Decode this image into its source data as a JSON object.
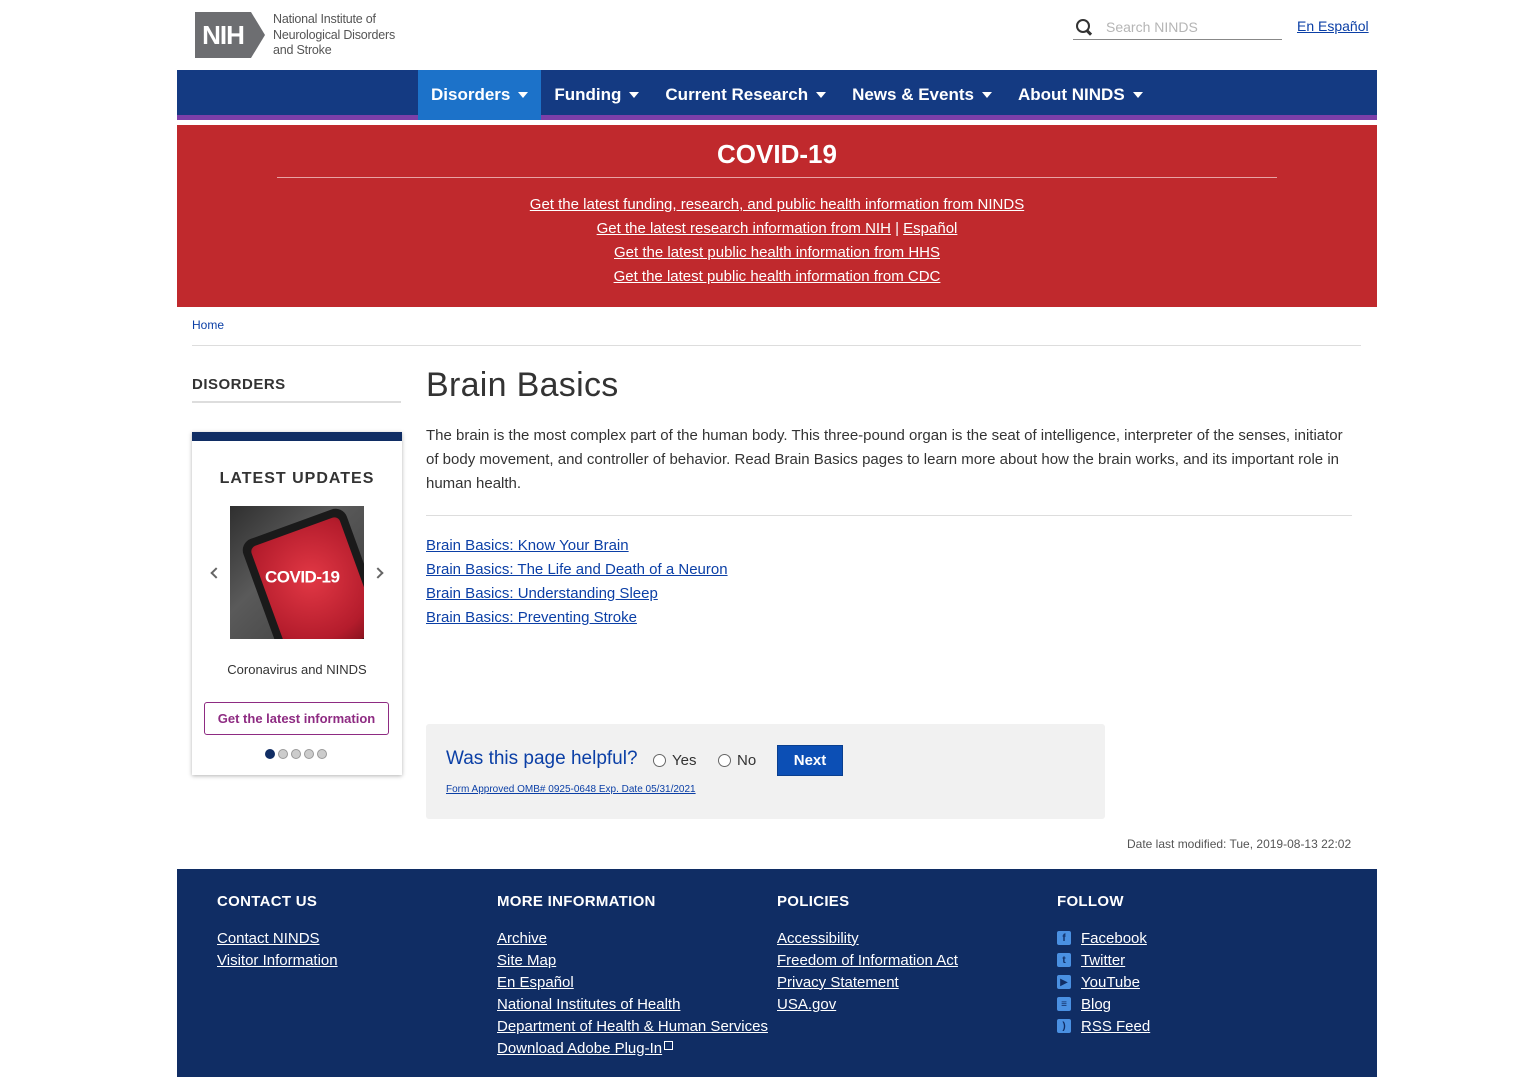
{
  "header": {
    "logo_abbr": "NIH",
    "logo_text_lines": [
      "National Institute of",
      "Neurological Disorders",
      "and Stroke"
    ],
    "search_placeholder": "Search NINDS",
    "espanol_link": "En Español"
  },
  "nav": {
    "items": [
      {
        "label": "Disorders",
        "active": true
      },
      {
        "label": "Funding",
        "active": false
      },
      {
        "label": "Current Research",
        "active": false
      },
      {
        "label": "News & Events",
        "active": false
      },
      {
        "label": "About NINDS",
        "active": false
      }
    ]
  },
  "covid": {
    "title": "COVID-19",
    "link1": "Get the latest funding, research, and public health information from NINDS",
    "link2a": "Get the latest research information from NIH",
    "separator": "|",
    "link2b": "Español",
    "link3": "Get the latest public health information from HHS",
    "link4": "Get the latest public health information from CDC"
  },
  "breadcrumb": {
    "home": "Home"
  },
  "sidebar": {
    "title": "DISORDERS",
    "updates_title": "LATEST UPDATES",
    "slide_image_text": "COVID-19",
    "slide_caption": "Coronavirus and NINDS",
    "slide_button": "Get the latest information",
    "slide_count": 5,
    "active_slide": 1
  },
  "main": {
    "title": "Brain Basics",
    "intro": "The brain is the most complex part of the human body. This three-pound organ is the seat of intelligence, interpreter of the senses, initiator of body movement, and controller of behavior. Read Brain Basics pages to learn more about how the brain works, and its important role in human health.",
    "links": [
      "Brain Basics: Know Your Brain",
      "Brain Basics: The Life and Death of a Neuron",
      "Brain Basics: Understanding Sleep",
      "Brain Basics: Preventing Stroke"
    ]
  },
  "feedback": {
    "question": "Was this page helpful?",
    "yes": "Yes",
    "no": "No",
    "next": "Next",
    "omb": "Form Approved OMB# 0925-0648 Exp. Date 05/31/2021"
  },
  "modified": "Date last modified: Tue, 2019-08-13 22:02",
  "footer": {
    "contact": {
      "title": "CONTACT US",
      "links": [
        "Contact NINDS",
        "Visitor Information"
      ]
    },
    "more": {
      "title": "MORE INFORMATION",
      "links": [
        "Archive",
        "Site Map",
        "En Español",
        "National Institutes of Health",
        "Department of Health & Human Services",
        "Download Adobe Plug-In"
      ]
    },
    "policies": {
      "title": "POLICIES",
      "links": [
        "Accessibility",
        "Freedom of Information Act",
        "Privacy Statement",
        "USA.gov"
      ]
    },
    "follow": {
      "title": "FOLLOW",
      "links": [
        "Facebook",
        "Twitter",
        "YouTube",
        "Blog",
        "RSS Feed"
      ],
      "icons": [
        "facebook-icon",
        "twitter-icon",
        "youtube-icon",
        "blog-icon",
        "rss-icon"
      ]
    }
  },
  "colors": {
    "nav_bg": "#143a82",
    "nav_active": "#1c72c9",
    "covid_red": "#c0292d",
    "footer_bg": "#102d64",
    "link_blue": "#0b3fa6",
    "accent_purple": "#8e2b82"
  }
}
